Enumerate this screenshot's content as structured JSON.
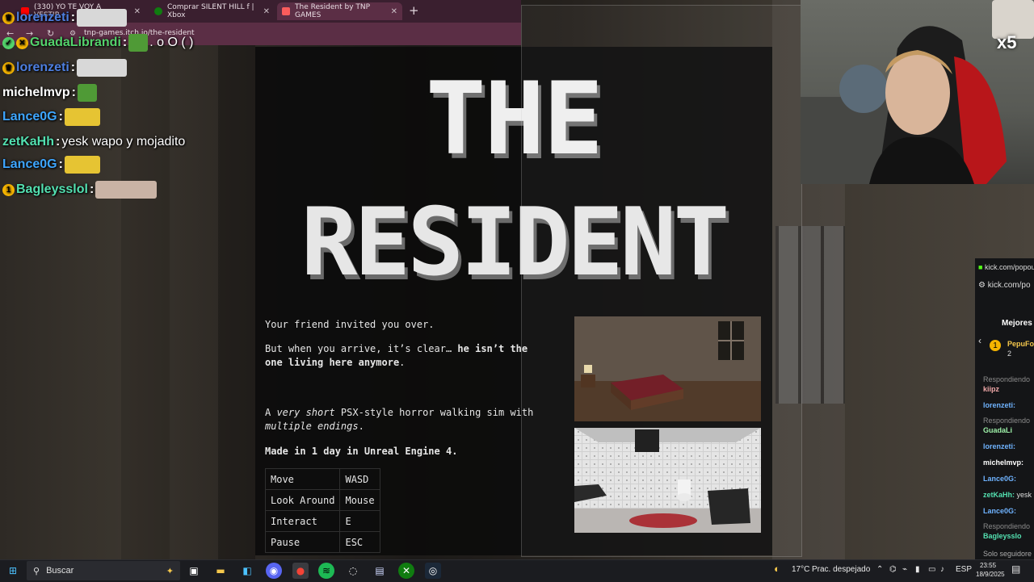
{
  "browser": {
    "tabs": [
      {
        "label": "(330) YO TE VOY A VESTIR ... "
      },
      {
        "label": "Comprar SILENT HILL f | Xbox"
      },
      {
        "label": "The Resident by TNP GAMES"
      }
    ],
    "new_tab": "+",
    "url": "tnp-games.itch.io/the-resident"
  },
  "game_page": {
    "title_line1": "THE",
    "title_line2": "RESIDENT",
    "intro": "Your friend invited you over.",
    "arrive_text": "But when you arrive, it’s clear… ",
    "arrive_bold": "he isn’t the one living here anymore",
    "arrive_end": ".",
    "desc_prefix": "A ",
    "desc_em1": "very short",
    "desc_mid": " PSX-style horror walking sim with ",
    "desc_em2": "multiple endings",
    "desc_end": ".",
    "made_in": "Made in 1 day in Unreal Engine 4.",
    "controls": [
      {
        "action": "Move",
        "key": "WASD"
      },
      {
        "action": "Look Around",
        "key": "Mouse"
      },
      {
        "action": "Interact",
        "key": "E"
      },
      {
        "action": "Pause",
        "key": "ESC"
      }
    ]
  },
  "chat": [
    {
      "user": "lorenzeti",
      "color": "#4d7fe0",
      "msg": ""
    },
    {
      "user": "GuadaLibrandi",
      "color": "#53d36b",
      "msg": " . o O ( )"
    },
    {
      "user": "lorenzeti",
      "color": "#4d7fe0",
      "msg": ""
    },
    {
      "user": "michelmvp",
      "color": "#ffffff",
      "msg": ""
    },
    {
      "user": "Lance0G",
      "color": "#3ea6ff",
      "msg": ""
    },
    {
      "user": "zetKaHh",
      "color": "#53e0b0",
      "msg": "yesk wapo y mojadito"
    },
    {
      "user": "Lance0G",
      "color": "#3ea6ff",
      "msg": ""
    },
    {
      "user": "Bagleysslol",
      "color": "#53e0b0",
      "msg": ""
    }
  ],
  "chat_sep": ":",
  "webcam": {
    "multiplier": "x5"
  },
  "kick": {
    "url1": "kick.com/popou",
    "url2": "kick.com/po",
    "heading": "Mejores",
    "top_user": "PepuFo",
    "top_count": "2",
    "replying": "Respondiendo",
    "lines": [
      {
        "user": "kiipz",
        "msg": ""
      },
      {
        "user": "lorenzeti:",
        "msg": ""
      },
      {
        "user": "GuadaLi",
        "msg": ""
      },
      {
        "user": "lorenzeti:",
        "msg": ""
      },
      {
        "user": "michelmvp:",
        "msg": ""
      },
      {
        "user": "Lance0G:",
        "msg": ""
      },
      {
        "user": "zetKaHh:",
        "msg": "yesk"
      },
      {
        "user": "Lance0G:",
        "msg": ""
      },
      {
        "user": "Bagleysslo",
        "msg": ""
      }
    ],
    "footer": "Solo seguidore"
  },
  "taskbar": {
    "search_placeholder": "Buscar",
    "weather_temp": "17°C",
    "weather_desc": "Prac. despejado",
    "lang": "ESP",
    "time": "23:55",
    "date": "18/9/2025"
  },
  "colors": {
    "tab_bar": "#3a1f2f",
    "address_bar": "#5b2e45",
    "taskbar": "#1b1c20",
    "kick_green": "#53fc18"
  }
}
